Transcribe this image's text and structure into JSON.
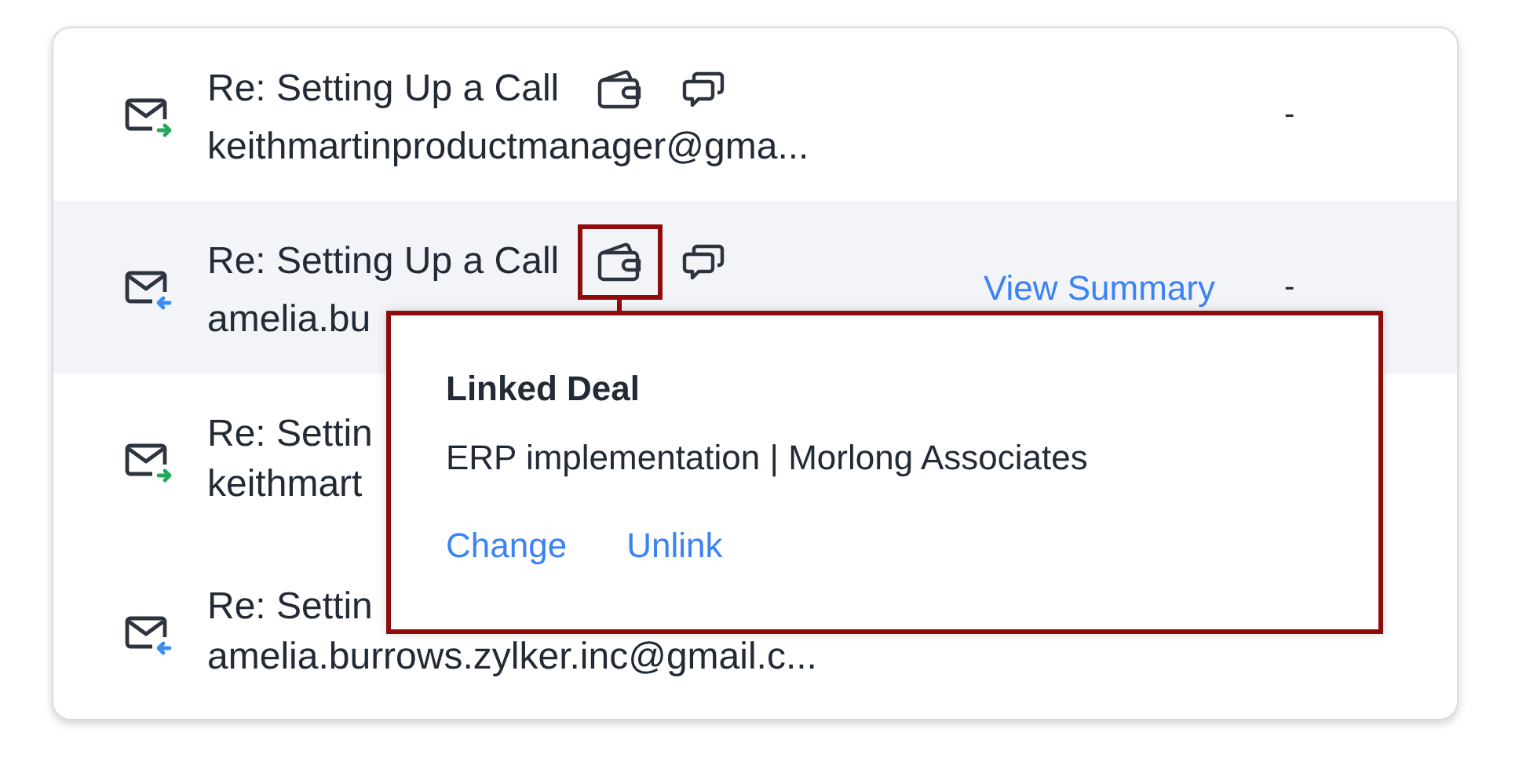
{
  "emails": [
    {
      "kind": "outgoing",
      "subject": "Re: Setting Up a Call",
      "sender": "keithmartinproductmanager@gma...",
      "deal_highlighted": false,
      "hovered": false,
      "status": "-"
    },
    {
      "kind": "incoming",
      "subject": "Re: Setting Up a Call",
      "sender": "amelia.bu",
      "deal_highlighted": true,
      "hovered": true,
      "action": "View Summary",
      "status": "-"
    },
    {
      "kind": "outgoing",
      "subject": "Re: Settin",
      "sender": "keithmart",
      "hovered": false
    },
    {
      "kind": "incoming",
      "subject": "Re: Settin",
      "sender": "amelia.burrows.zylker.inc@gmail.c...",
      "hovered": false
    }
  ],
  "popup": {
    "title": "Linked Deal",
    "deal": "ERP implementation | Morlong Associates",
    "links": [
      "Change",
      "Unlink"
    ]
  }
}
